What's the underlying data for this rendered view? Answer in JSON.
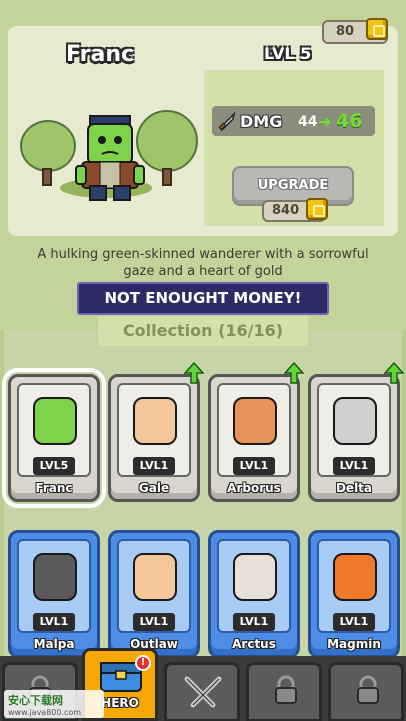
{
  "hero": {
    "name": "Franc",
    "level": "LVL 5",
    "description": "A hulking green-skinned wanderer with a sorrowful gaze and a heart of gold"
  },
  "currency": {
    "gold": "80",
    "icon": "gold-coin-icon"
  },
  "stats": {
    "dmg_label": "DMG",
    "dmg_current": "44",
    "dmg_next": "46",
    "dmg_icon": "sword-icon"
  },
  "upgrade": {
    "label": "UPGRADE",
    "cost": "840"
  },
  "toast": "NOT ENOUGHT MONEY!",
  "collection": {
    "title": "Collection (16/16)",
    "cards": [
      {
        "name": "Franc",
        "level": "LVL5",
        "tier": "gray",
        "selected": true,
        "upgradable": false
      },
      {
        "name": "Gale",
        "level": "LVL1",
        "tier": "gray",
        "selected": false,
        "upgradable": false
      },
      {
        "name": "Arborus",
        "level": "LVL1",
        "tier": "gray",
        "selected": false,
        "upgradable": true
      },
      {
        "name": "Delta",
        "level": "LVL1",
        "tier": "gray",
        "selected": false,
        "upgradable": true
      },
      {
        "name": "Malpa",
        "level": "LVL1",
        "tier": "blue",
        "selected": false,
        "upgradable": false
      },
      {
        "name": "Outlaw",
        "level": "LVL1",
        "tier": "blue",
        "selected": false,
        "upgradable": false
      },
      {
        "name": "Arctus",
        "level": "LVL1",
        "tier": "blue",
        "selected": false,
        "upgradable": false
      },
      {
        "name": "Magmin",
        "level": "LVL1",
        "tier": "blue",
        "selected": false,
        "upgradable": false
      }
    ]
  },
  "tabs": [
    {
      "label": "",
      "icon": "lock-icon"
    },
    {
      "label": "HERO",
      "icon": "hero-chest-icon",
      "badge": "!"
    },
    {
      "label": "",
      "icon": "crossed-swords-icon"
    },
    {
      "label": "",
      "icon": "lock-icon"
    },
    {
      "label": "",
      "icon": "lock-icon"
    }
  ],
  "watermark": {
    "title": "安心下载网",
    "url": "www.java800.com"
  },
  "colors": {
    "accent_green": "#6fe02c",
    "toast_bg": "#2d2b66",
    "active_tab": "#f6a800",
    "blue_card": "#4e8de6"
  }
}
